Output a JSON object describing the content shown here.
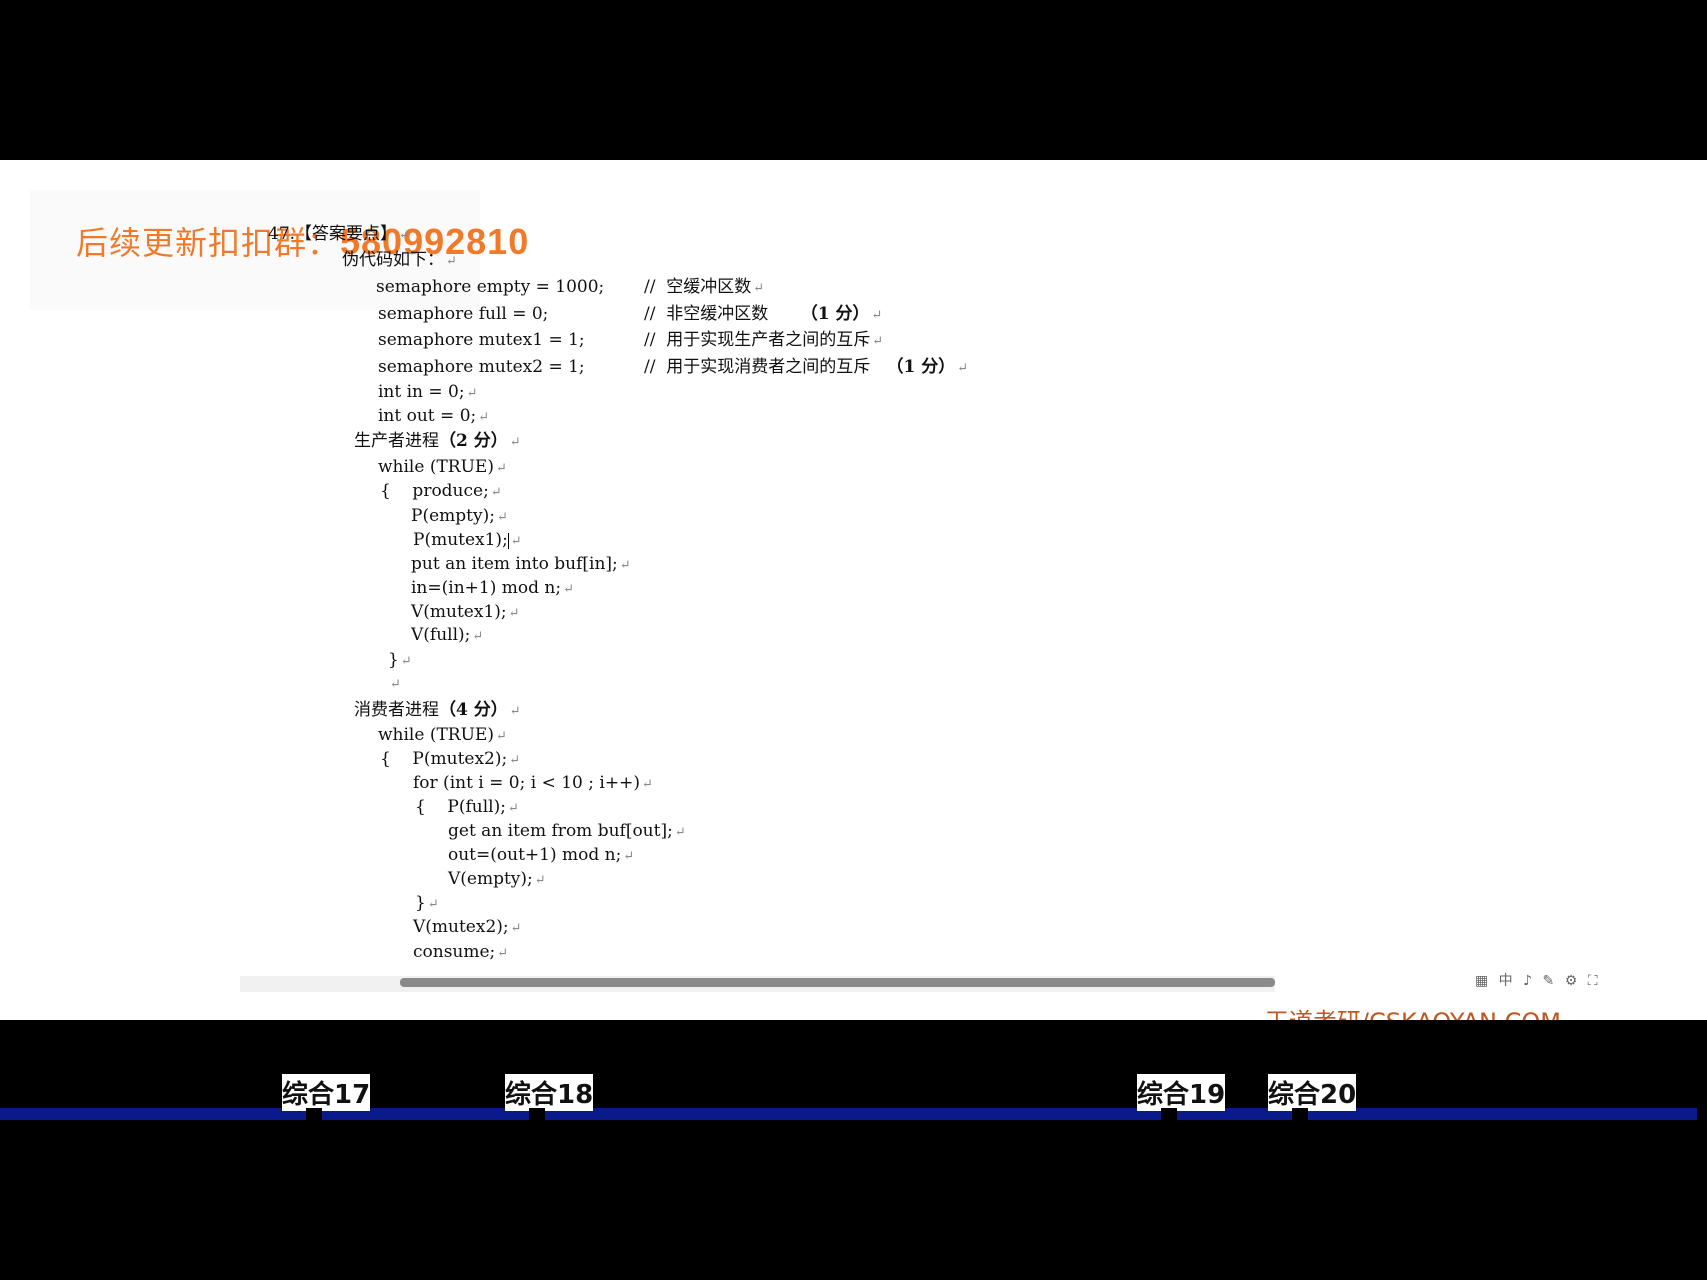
{
  "banner": {
    "prefix": "后续更新扣扣群：",
    "number": "580992810"
  },
  "doc": {
    "heading": "47.【答案要点】",
    "intro": "伪代码如下：",
    "declarations": [
      {
        "code": "semaphore empty = 1000;",
        "comment": "//  空缓冲区数",
        "score": ""
      },
      {
        "code": "semaphore full = 0;",
        "comment": "//  非空缓冲区数",
        "score": "（1 分）"
      },
      {
        "code": "semaphore mutex1 = 1;",
        "comment": "//  用于实现生产者之间的互斥",
        "score": ""
      },
      {
        "code": "semaphore mutex2 = 1;",
        "comment": "//  用于实现消费者之间的互斥",
        "score": "（1 分）"
      },
      {
        "code": "int in = 0;",
        "comment": "",
        "score": ""
      },
      {
        "code": "int out = 0;",
        "comment": "",
        "score": ""
      }
    ],
    "producer_title": "生产者进程",
    "producer_score": "（2 分）",
    "producer_lines": [
      "while (TRUE)",
      "{    produce;",
      "P(empty);",
      "P(mutex1);",
      "put an item into buf[in];",
      "in=(in+1) mod n;",
      "V(mutex1);",
      "V(full);",
      "}"
    ],
    "consumer_title": "消费者进程",
    "consumer_score": "（4 分）",
    "consumer_lines": [
      "while (TRUE)",
      "{    P(mutex2);",
      "for (int i = 0; i < 10 ; i++)",
      "{    P(full);",
      "get an item from buf[out];",
      "out=(out+1) mod n;",
      "V(empty);",
      "}",
      "V(mutex2);",
      "consume;"
    ],
    "return_mark": "↵"
  },
  "status_icons": "▦ 中 ♪ ✎ ⚙ ⛶",
  "site_credit": "王道考研/CSKAOYAN.COM",
  "chapters": [
    "综合17",
    "综合18",
    "综合19",
    "综合20"
  ]
}
